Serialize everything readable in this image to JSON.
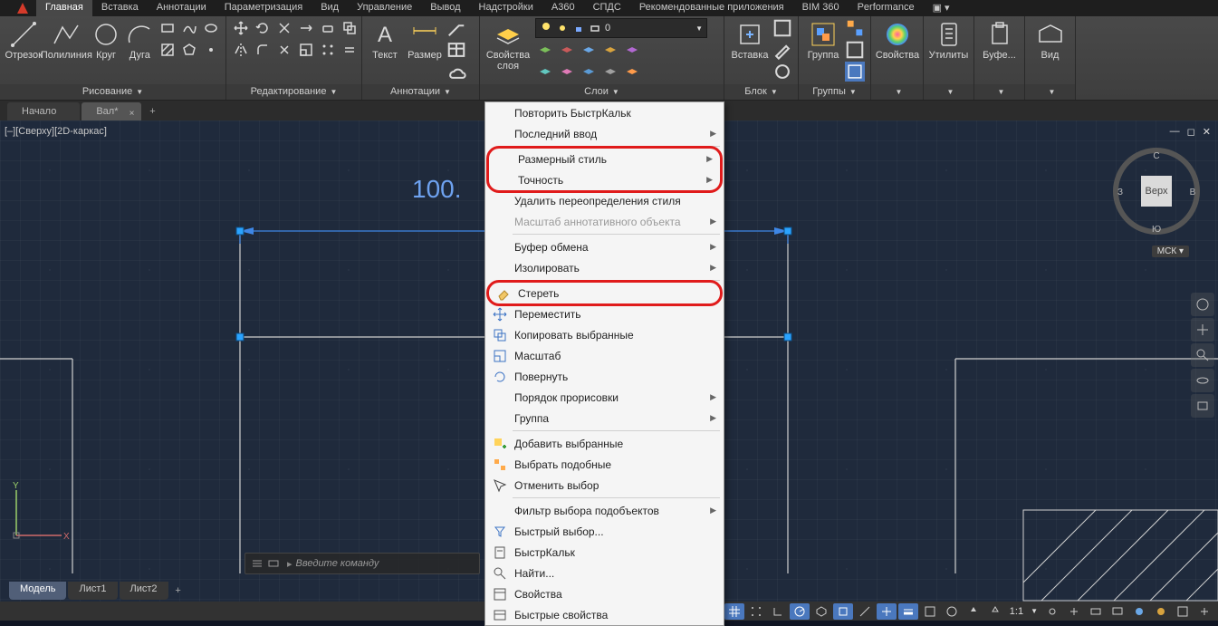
{
  "tabs": {
    "main": "Главная",
    "insert": "Вставка",
    "annot": "Аннотации",
    "param": "Параметризация",
    "view": "Вид",
    "manage": "Управление",
    "output": "Вывод",
    "addins": "Надстройки",
    "a360": "A360",
    "spds": "СПДС",
    "recom": "Рекомендованные приложения",
    "bim": "BIM 360",
    "perf": "Performance"
  },
  "ribbon": {
    "draw": {
      "title": "Рисование",
      "segment": "Отрезок",
      "polyline": "Полилиния",
      "circle": "Круг",
      "arc": "Дуга"
    },
    "edit": {
      "title": "Редактирование"
    },
    "annotation": {
      "title": "Аннотации",
      "text": "Текст",
      "dim": "Размер"
    },
    "layers": {
      "title": "Слои",
      "propsLabel": "Свойства\nслоя",
      "combo": "0"
    },
    "block": {
      "title": "Блок",
      "insert": "Вставка"
    },
    "group": {
      "title": "Группы",
      "group": "Группа"
    },
    "props": {
      "title": "",
      "label": "Свойства"
    },
    "util": {
      "title": "",
      "label": "Утилиты"
    },
    "clip": {
      "title": "",
      "label": "Буфе..."
    },
    "viewpanel": {
      "title": "",
      "label": "Вид"
    }
  },
  "doctabs": {
    "start": "Начало",
    "active": "Вал*"
  },
  "viewport": {
    "label": "[–][Сверху][2D-каркас]",
    "dimension": "100.",
    "cube": "Верх",
    "cubeN": "С",
    "cubeS": "Ю",
    "cubeE": "В",
    "cubeW": "З",
    "msk": "МСК"
  },
  "cmd": {
    "prompt": "Введите команду",
    "chev": "▸"
  },
  "layouts": {
    "model": "Модель",
    "l1": "Лист1",
    "l2": "Лист2"
  },
  "status": {
    "scale": "1:1"
  },
  "context": {
    "repeat": "Повторить БыстрКальк",
    "lastinput": "Последний ввод",
    "dimstyle": "Размерный стиль",
    "precision": "Точность",
    "removeoverride": "Удалить переопределения стиля",
    "annoscale": "Масштаб аннотативного объекта",
    "clipboard": "Буфер обмена",
    "isolate": "Изолировать",
    "erase": "Стереть",
    "move": "Переместить",
    "copysel": "Копировать выбранные",
    "scale": "Масштаб",
    "rotate": "Повернуть",
    "draworder": "Порядок прорисовки",
    "group": "Группа",
    "addsel": "Добавить выбранные",
    "selsimilar": "Выбрать подобные",
    "deselect": "Отменить выбор",
    "subfilter": "Фильтр выбора подобъектов",
    "qselect": "Быстрый выбор...",
    "qcalc": "БыстрКальк",
    "find": "Найти...",
    "props": "Свойства",
    "qprops": "Быстрые свойства"
  }
}
